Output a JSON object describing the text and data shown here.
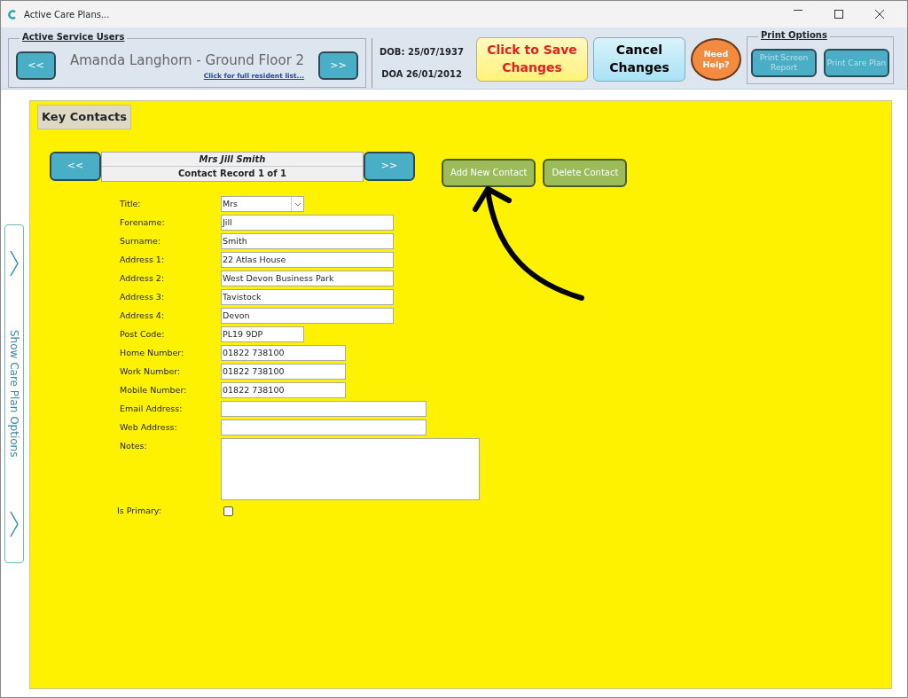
{
  "window": {
    "title": "Active Care Plans..."
  },
  "service_users": {
    "legend": "Active Service Users",
    "prev": "<<",
    "next": ">>",
    "current": "Amanda Langhorn - Ground Floor 2",
    "list_link": "Click for full resident list...",
    "dob": "DOB: 25/07/1937",
    "doa": "DOA 26/01/2012"
  },
  "save_button": "Click to Save Changes",
  "cancel_button": "Cancel Changes",
  "help_button": "Need Help?",
  "print_options": {
    "legend": "Print Options",
    "buttons": [
      {
        "label": "Print Screen Report",
        "disabled": true
      },
      {
        "label": "Print Care Plan",
        "disabled": true
      }
    ]
  },
  "side_tab": {
    "label": "Show Care Plan Options"
  },
  "panel": {
    "title": "Key Contacts",
    "prev": "<<",
    "next": ">>",
    "record_name": "Mrs Jill Smith",
    "record_count": "Contact Record 1 of 1",
    "actions": [
      "Add New Contact",
      "Delete Contact"
    ],
    "fields": [
      {
        "kind": "select",
        "label": "Title:",
        "value": "Mrs"
      },
      {
        "kind": "text",
        "label": "Forename:",
        "value": "Jill"
      },
      {
        "kind": "text",
        "label": "Surname:",
        "value": "Smith"
      },
      {
        "kind": "text",
        "label": "Address 1:",
        "value": "22 Atlas House"
      },
      {
        "kind": "text",
        "label": "Address 2:",
        "value": "West Devon Business Park"
      },
      {
        "kind": "text",
        "label": "Address 3:",
        "value": "Tavistock"
      },
      {
        "kind": "text",
        "label": "Address 4:",
        "value": "Devon"
      },
      {
        "kind": "text",
        "label": "Post Code:",
        "value": "PL19 9DP"
      },
      {
        "kind": "text",
        "label": "Home Number:",
        "value": "01822 738100"
      },
      {
        "kind": "text",
        "label": "Work Number:",
        "value": "01822 738100"
      },
      {
        "kind": "text",
        "label": "Mobile Number:",
        "value": "01822 738100"
      },
      {
        "kind": "text",
        "label": "Email Address:"
      },
      {
        "kind": "text",
        "label": "Web Address:"
      },
      {
        "kind": "textarea",
        "label": "Notes:"
      },
      {
        "kind": "checkbox",
        "label": "Is Primary:",
        "checked": false
      }
    ]
  }
}
